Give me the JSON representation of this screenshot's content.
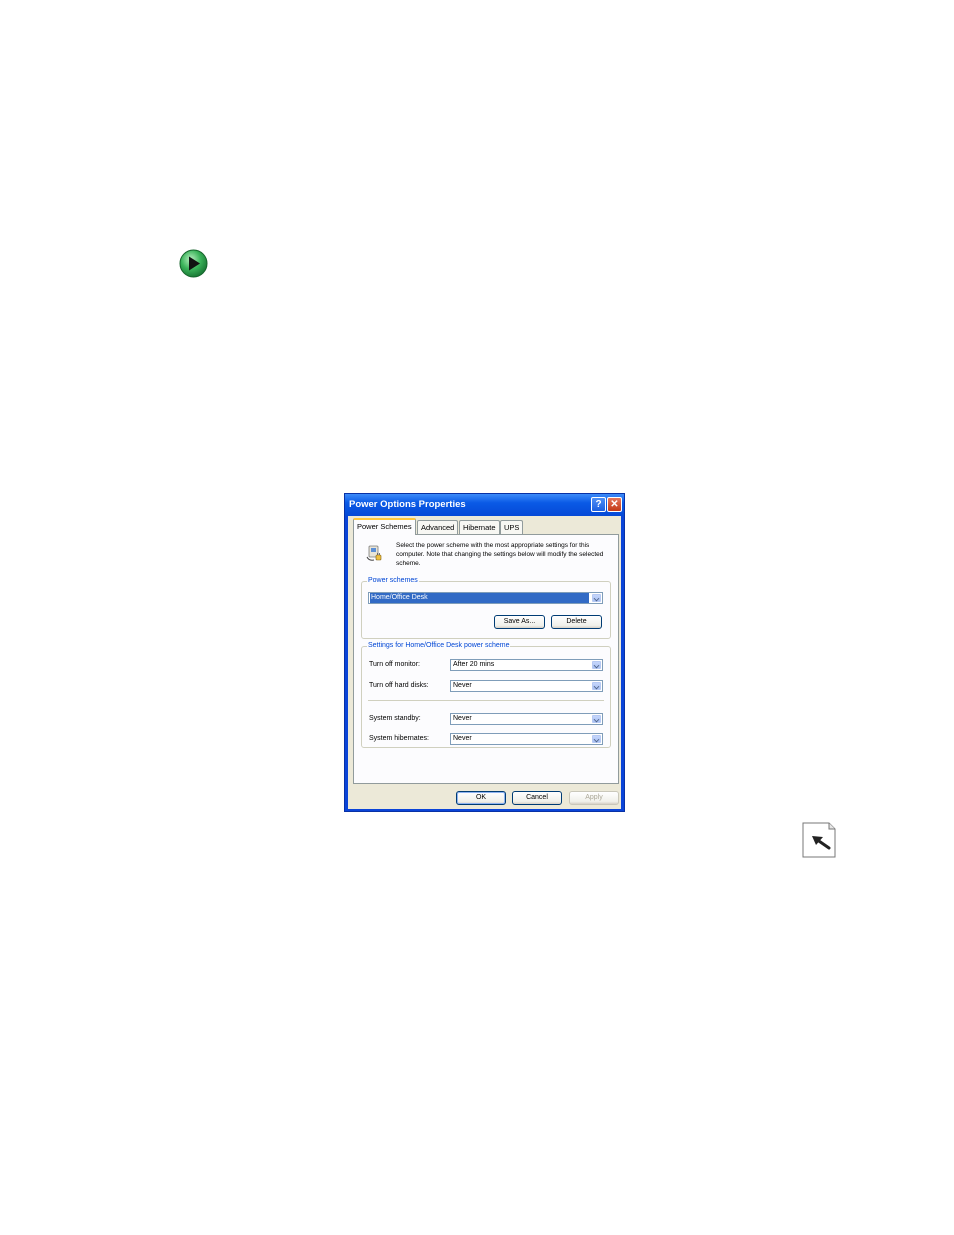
{
  "dialog": {
    "title": "Power Options Properties",
    "help_label": "?",
    "close_label": "✕",
    "tabs": [
      {
        "label": "Power Schemes",
        "active": true
      },
      {
        "label": "Advanced",
        "active": false
      },
      {
        "label": "Hibernate",
        "active": false
      },
      {
        "label": "UPS",
        "active": false
      }
    ],
    "intro_text": "Select the power scheme with the most appropriate settings for this computer. Note that changing the settings below will modify the selected scheme.",
    "power_schemes": {
      "legend": "Power schemes",
      "selected": "Home/Office Desk",
      "save_as_label": "Save As...",
      "delete_label": "Delete"
    },
    "settings": {
      "legend": "Settings for Home/Office Desk power scheme",
      "rows": [
        {
          "label": "Turn off monitor:",
          "value": "After 20 mins"
        },
        {
          "label": "Turn off hard disks:",
          "value": "Never"
        },
        {
          "label": "System standby:",
          "value": "Never"
        },
        {
          "label": "System hibernates:",
          "value": "Never"
        }
      ]
    },
    "buttons": {
      "ok": "OK",
      "cancel": "Cancel",
      "apply": "Apply"
    }
  },
  "icons": {
    "bullet": "green-play-arrow-icon",
    "power": "power-plug-icon",
    "note": "page-return-icon"
  },
  "colors": {
    "titlebar": "#0a5ae6",
    "bullet_green": "#2e9e4a",
    "selection": "#316ac5",
    "legend_text": "#0046d5"
  }
}
